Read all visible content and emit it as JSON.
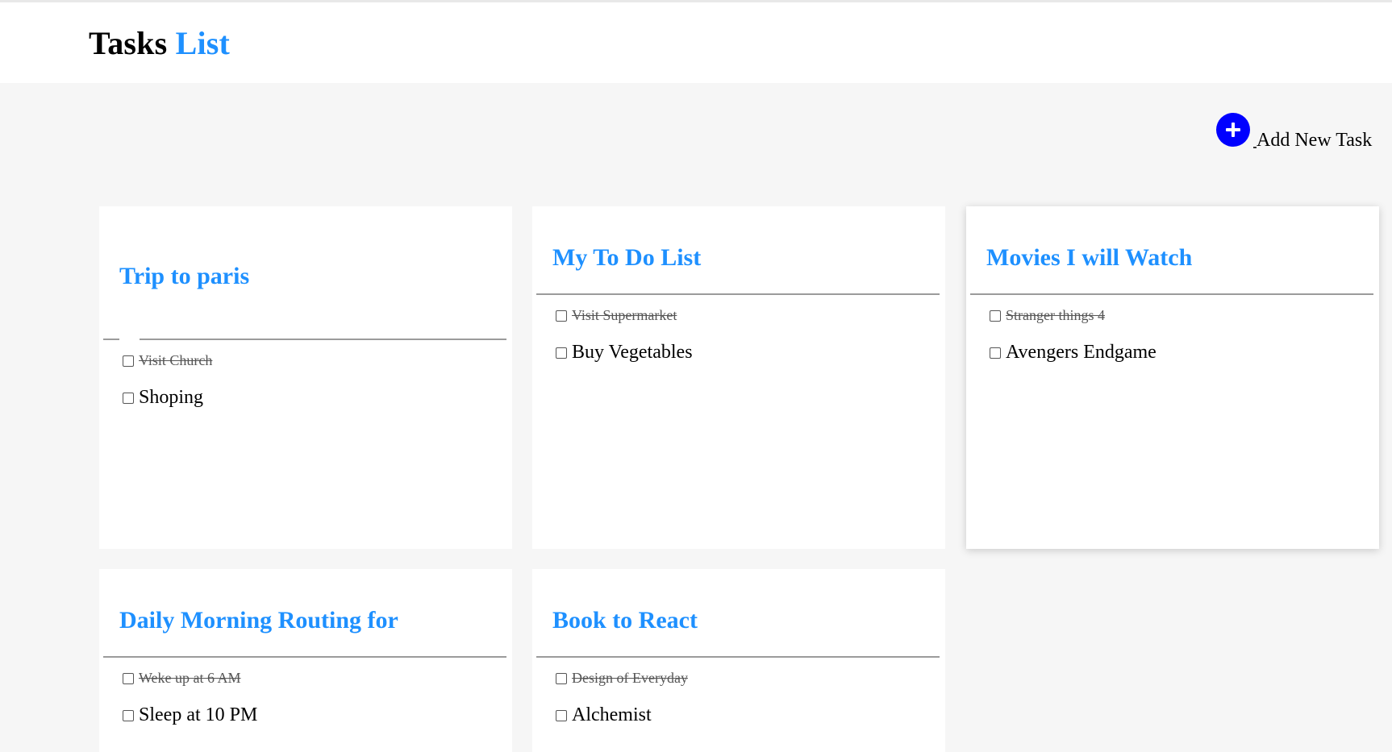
{
  "header": {
    "title_main": "Tasks",
    "title_accent": "List"
  },
  "add_task": {
    "label": "Add New Task",
    "icon": "plus-icon",
    "icon_color": "#0000ff"
  },
  "accent_color": "#1e90ff",
  "lists": [
    {
      "title": "Trip to paris",
      "tasks": [
        {
          "text": "Visit Church",
          "done": true
        },
        {
          "text": "Shoping",
          "done": false
        }
      ]
    },
    {
      "title": "My To Do List",
      "tasks": [
        {
          "text": "Visit Supermarket",
          "done": true
        },
        {
          "text": "Buy Vegetables",
          "done": false
        }
      ]
    },
    {
      "title": "Movies I will Watch",
      "tasks": [
        {
          "text": "Stranger things 4",
          "done": true
        },
        {
          "text": "Avengers Endgame",
          "done": false
        }
      ]
    },
    {
      "title": "Daily Morning Routing for",
      "tasks": [
        {
          "text": "Weke up at 6 AM",
          "done": true
        },
        {
          "text": "Sleep at 10 PM",
          "done": false
        }
      ]
    },
    {
      "title": "Book to React",
      "tasks": [
        {
          "text": "Design of Everyday",
          "done": true
        },
        {
          "text": "Alchemist",
          "done": false
        }
      ]
    }
  ]
}
